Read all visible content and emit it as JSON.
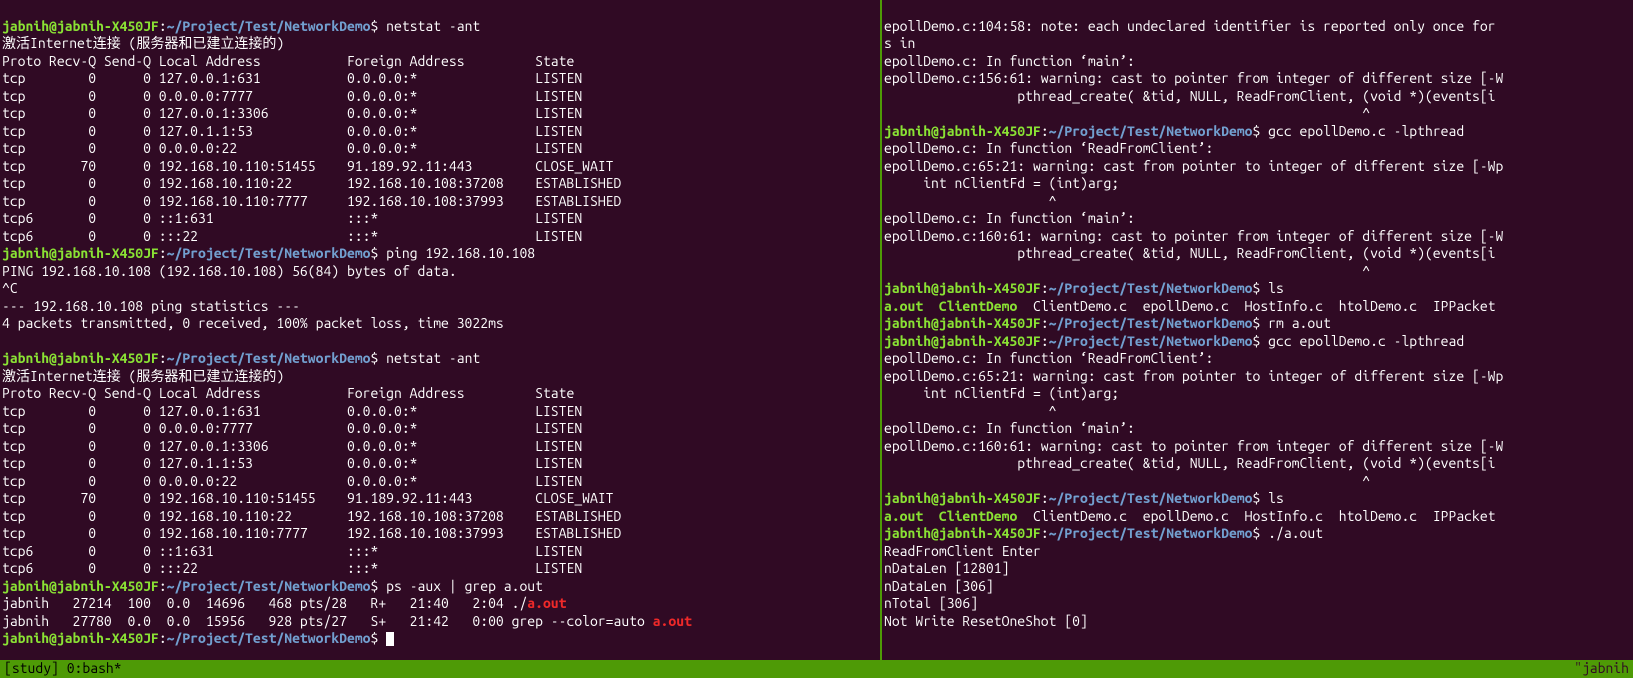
{
  "prompt": {
    "userhost": "jabnih@jabnih-X450JF",
    "path": "~/Project/Test/NetworkDemo",
    "sep": ":",
    "dollar": "$"
  },
  "left": {
    "topPartial": "jabnih@jabnih-X450JF:~/Project/Test/NetworkDemo$ netstat -ant",
    "cmd_netstat1": " netstat -ant",
    "netstat_header_cn": "激活Internet连接 (服务器和已建立连接的)",
    "netstat_cols": "Proto Recv-Q Send-Q Local Address           Foreign Address         State",
    "rows1": [
      "tcp        0      0 127.0.0.1:631           0.0.0.0:*               LISTEN",
      "tcp        0      0 0.0.0.0:7777            0.0.0.0:*               LISTEN",
      "tcp        0      0 127.0.0.1:3306          0.0.0.0:*               LISTEN",
      "tcp        0      0 127.0.1.1:53            0.0.0.0:*               LISTEN",
      "tcp        0      0 0.0.0.0:22              0.0.0.0:*               LISTEN",
      "tcp       70      0 192.168.10.110:51455    91.189.92.11:443        CLOSE_WAIT",
      "tcp        0      0 192.168.10.110:22       192.168.10.108:37208    ESTABLISHED",
      "tcp        0      0 192.168.10.110:7777     192.168.10.108:37993    ESTABLISHED",
      "tcp6       0      0 ::1:631                 :::*                    LISTEN",
      "tcp6       0      0 :::22                   :::*                    LISTEN"
    ],
    "cmd_ping": " ping 192.168.10.108",
    "ping1": "PING 192.168.10.108 (192.168.10.108) 56(84) bytes of data.",
    "ping2": "^C",
    "ping3": "--- 192.168.10.108 ping statistics ---",
    "ping4": "4 packets transmitted, 0 received, 100% packet loss, time 3022ms",
    "blank": "",
    "cmd_netstat2": " netstat -ant",
    "rows2": [
      "tcp        0      0 127.0.0.1:631           0.0.0.0:*               LISTEN",
      "tcp        0      0 0.0.0.0:7777            0.0.0.0:*               LISTEN",
      "tcp        0      0 127.0.0.1:3306          0.0.0.0:*               LISTEN",
      "tcp        0      0 127.0.1.1:53            0.0.0.0:*               LISTEN",
      "tcp        0      0 0.0.0.0:22              0.0.0.0:*               LISTEN",
      "tcp       70      0 192.168.10.110:51455    91.189.92.11:443        CLOSE_WAIT",
      "tcp        0      0 192.168.10.110:22       192.168.10.108:37208    ESTABLISHED",
      "tcp        0      0 192.168.10.110:7777     192.168.10.108:37993    ESTABLISHED",
      "tcp6       0      0 ::1:631                 :::*                    LISTEN",
      "tcp6       0      0 :::22                   :::*                    LISTEN"
    ],
    "cmd_ps": " ps -aux | grep a.out",
    "ps1_pre": "jabnih   27214  100  0.0  14696   468 pts/28   R+   21:40   2:04 ./",
    "ps1_red": "a.out",
    "ps2_pre": "jabnih   27780  0.0  0.0  15956   928 pts/27   S+   21:42   0:00 grep --color=auto ",
    "ps2_red": "a.out",
    "cmd_empty": " "
  },
  "right": {
    "l01": "epollDemo.c:104:58: note: each undeclared identifier is reported only once for",
    "l02": "s in",
    "l03": "epollDemo.c: In function ‘main’:",
    "l04": "epollDemo.c:156:61: warning: cast to pointer from integer of different size [-W",
    "l05": "                 pthread_create( &tid, NULL, ReadFromClient, (void *)(events[i",
    "l06": "                                                             ^",
    "cmd_gcc1": " gcc epollDemo.c -lpthread",
    "l08": "epollDemo.c: In function ‘ReadFromClient’:",
    "l09": "epollDemo.c:65:21: warning: cast from pointer to integer of different size [-Wp",
    "l10": "     int nClientFd = (int)arg;",
    "l11": "                     ^",
    "l12": "epollDemo.c: In function ‘main’:",
    "l13": "epollDemo.c:160:61: warning: cast to pointer from integer of different size [-W",
    "l14": "                 pthread_create( &tid, NULL, ReadFromClient, (void *)(events[i",
    "l15": "                                                             ^",
    "cmd_ls1": " ls",
    "ls_exe1": "a.out",
    "ls_exe2": "ClientDemo",
    "ls_rest": "  ClientDemo.c  epollDemo.c  HostInfo.c  htolDemo.c  IPPacket",
    "cmd_rm": " rm a.out",
    "cmd_gcc2": " gcc epollDemo.c -lpthread",
    "l20": "epollDemo.c: In function ‘ReadFromClient’:",
    "l21": "epollDemo.c:65:21: warning: cast from pointer to integer of different size [-Wp",
    "l22": "     int nClientFd = (int)arg;",
    "l23": "                     ^",
    "l24": "epollDemo.c: In function ‘main’:",
    "l25": "epollDemo.c:160:61: warning: cast to pointer from integer of different size [-W",
    "l26": "                 pthread_create( &tid, NULL, ReadFromClient, (void *)(events[i",
    "l27": "                                                             ^",
    "cmd_ls2": " ls",
    "cmd_run": " ./a.out",
    "out1": "ReadFromClient Enter",
    "out2": "nDataLen [12801]",
    "out3": "nDataLen [306]",
    "out4": "nTotal [306]",
    "out5": "Not Write ResetOneShot [0]"
  },
  "status": {
    "left": "[study] 0:bash*",
    "right": "\"jabnih"
  }
}
